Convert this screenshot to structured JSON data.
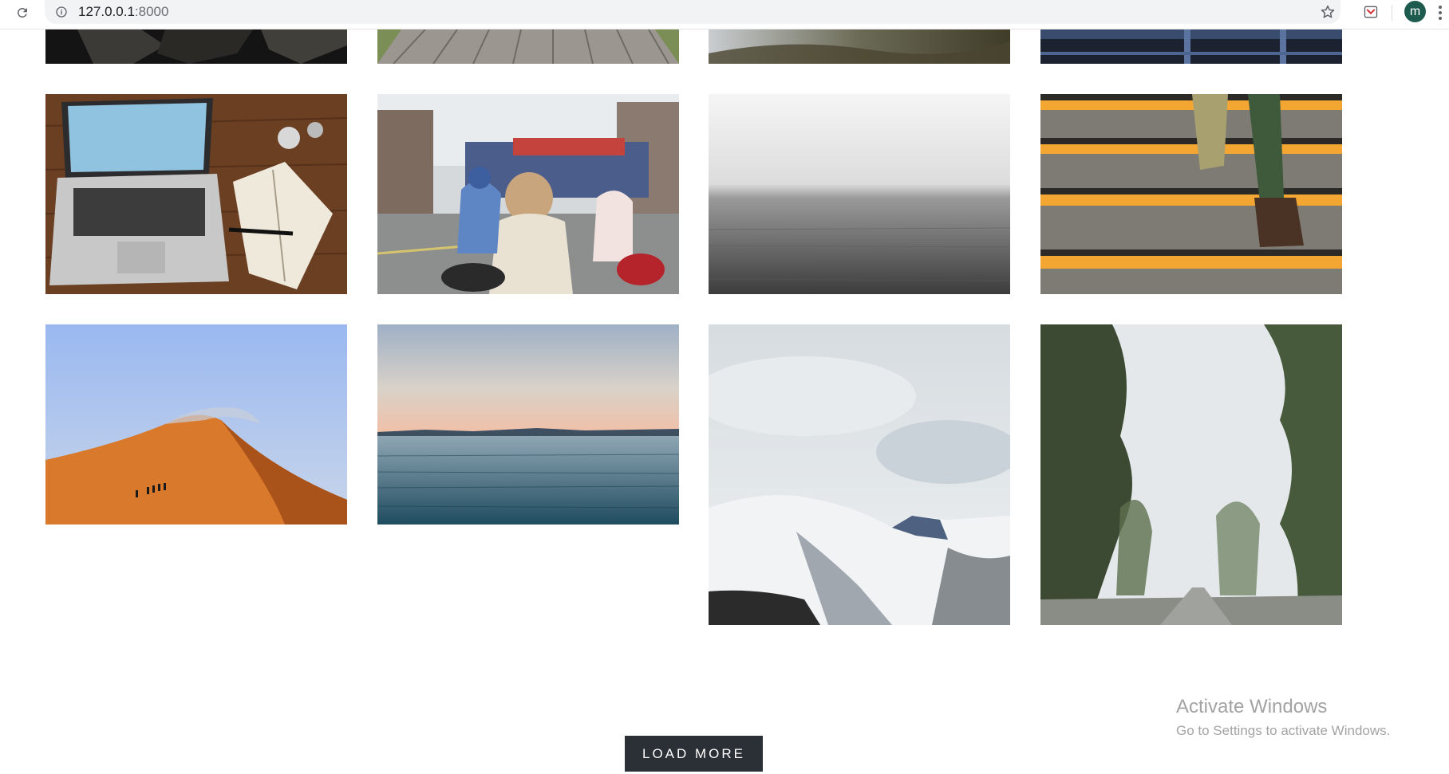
{
  "browser": {
    "url_host": "127.0.0.1",
    "url_port": ":8000",
    "profile_initial": "m"
  },
  "gallery": {
    "photos": [
      {
        "id": "row0-col0",
        "subject": "dark rocks"
      },
      {
        "id": "row0-col1",
        "subject": "wooden boardwalk"
      },
      {
        "id": "row0-col2",
        "subject": "misty mountain slope"
      },
      {
        "id": "row0-col3",
        "subject": "blue railing"
      },
      {
        "id": "row1-col0",
        "subject": "laptop and notebook on wooden desk"
      },
      {
        "id": "row1-col1",
        "subject": "street with scooters"
      },
      {
        "id": "row1-col2",
        "subject": "foggy grey sea"
      },
      {
        "id": "row1-col3",
        "subject": "stairs with yellow stripes"
      },
      {
        "id": "row2-col0",
        "subject": "orange sand dune"
      },
      {
        "id": "row2-col1",
        "subject": "calm sea at dusk"
      },
      {
        "id": "row2-col2",
        "subject": "snowy mountains"
      },
      {
        "id": "row2-col3",
        "subject": "foggy tree-lined road"
      }
    ]
  },
  "actions": {
    "load_more_label": "LOAD MORE"
  },
  "watermark": {
    "title": "Activate Windows",
    "subtitle": "Go to Settings to activate Windows."
  },
  "colors": {
    "button_bg": "#2b2f36",
    "avatar_bg": "#1e5b4f"
  }
}
